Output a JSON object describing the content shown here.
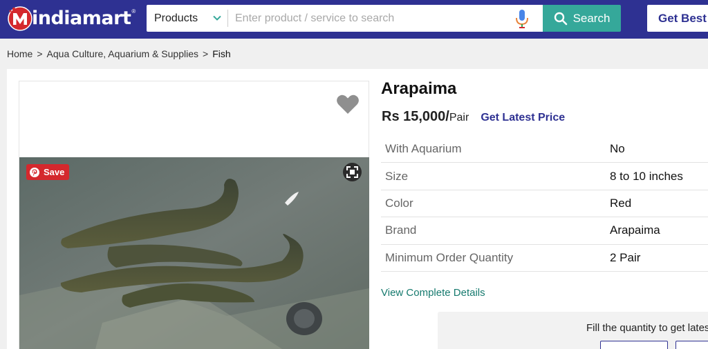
{
  "header": {
    "logo_text": "indiamart",
    "logo_reg": "®",
    "category": "Products",
    "search_placeholder": "Enter product / service to search",
    "search_label": "Search",
    "get_best_label": "Get Best"
  },
  "breadcrumb": {
    "items": [
      "Home",
      "Aqua Culture, Aquarium & Supplies",
      "Fish"
    ],
    "separator": ">"
  },
  "product": {
    "title": "Arapaima",
    "price": "Rs 15,000/",
    "unit": "Pair",
    "latest_price_label": "Get Latest Price",
    "save_label": "Save",
    "specs": [
      {
        "key": "With Aquarium",
        "value": "No"
      },
      {
        "key": "Size",
        "value": "8 to 10 inches"
      },
      {
        "key": "Color",
        "value": "Red"
      },
      {
        "key": "Brand",
        "value": "Arapaima"
      },
      {
        "key": "Minimum Order Quantity",
        "value": "2 Pair"
      }
    ],
    "view_details_label": "View Complete Details"
  },
  "enquiry": {
    "fill_quantity_text": "Fill the quantity to get latest price!"
  },
  "colors": {
    "header_bg": "#2e3192",
    "search_button": "#35a89a",
    "pin_red": "#d4282d",
    "link_teal": "#167a6e"
  }
}
